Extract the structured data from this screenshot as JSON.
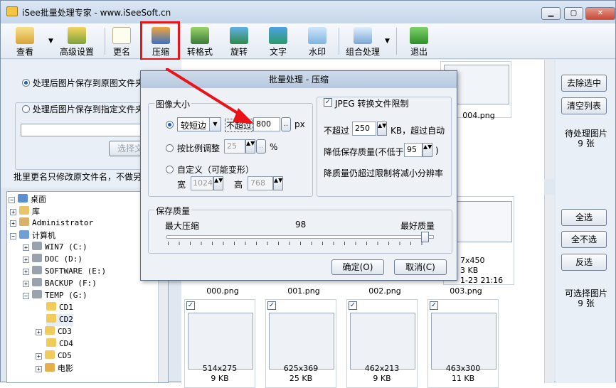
{
  "window": {
    "title": "iSee批量处理专家 - www.iSeeSoft.cn"
  },
  "toolbar": {
    "items": [
      {
        "label": "查看",
        "icon": "view-icon"
      },
      {
        "label": "高级设置",
        "icon": "advanced-settings-icon"
      },
      {
        "label": "更名",
        "icon": "rename-icon"
      },
      {
        "label": "压缩",
        "icon": "compress-icon"
      },
      {
        "label": "转格式",
        "icon": "convert-format-icon"
      },
      {
        "label": "旋转",
        "icon": "rotate-icon"
      },
      {
        "label": "文字",
        "icon": "text-icon"
      },
      {
        "label": "水印",
        "icon": "watermark-icon"
      },
      {
        "label": "组合处理",
        "icon": "combine-icon"
      },
      {
        "label": "退出",
        "icon": "exit-icon"
      }
    ]
  },
  "output": {
    "option_original": "处理后图片保存到原图文件夹",
    "option_specified": "处理后图片保存到指定文件夹",
    "choose_button": "选择文",
    "rename_note": "批里更名只修改原文件名，不做另"
  },
  "tree": {
    "rows": [
      {
        "label": "桌面",
        "icon": "desktop-icon"
      },
      {
        "label": "库",
        "icon": "library-icon"
      },
      {
        "label": "Administrator",
        "icon": "user-folder-icon"
      },
      {
        "label": "计算机",
        "icon": "computer-icon"
      },
      {
        "label": "WIN7 (C:)",
        "icon": "drive-icon"
      },
      {
        "label": "DOC (D:)",
        "icon": "drive-icon"
      },
      {
        "label": "SOFTWARE (E:)",
        "icon": "drive-icon"
      },
      {
        "label": "BACKUP (F:)",
        "icon": "drive-icon"
      },
      {
        "label": "TEMP (G:)",
        "icon": "drive-icon"
      },
      {
        "label": "CD1",
        "icon": "folder-icon"
      },
      {
        "label": "CD2",
        "icon": "folder-icon"
      },
      {
        "label": "CD3",
        "icon": "folder-icon"
      },
      {
        "label": "CD4",
        "icon": "folder-icon"
      },
      {
        "label": "CD5",
        "icon": "folder-icon"
      },
      {
        "label": "电影",
        "icon": "movie-folder-icon"
      }
    ]
  },
  "thumbnails": {
    "top_row": [
      {
        "name": "004.png"
      }
    ],
    "partial_info": {
      "size": "7x450",
      "kb": "3 KB",
      "date": "1-23 21:16"
    },
    "row1_names": [
      "000.png",
      "001.png",
      "002.png",
      "003.png"
    ],
    "row2": [
      {
        "dims": "514x275",
        "kb": "9 KB"
      },
      {
        "dims": "625x369",
        "kb": "25 KB"
      },
      {
        "dims": "462x213",
        "kb": "9 KB"
      },
      {
        "dims": "463x300",
        "kb": "11 KB"
      }
    ]
  },
  "right_panel": {
    "remove_selected": "去除选中",
    "clear_list": "清空列表",
    "pending_label": "待处理图片",
    "pending_count": "9 张",
    "select_all": "全选",
    "select_none": "全不选",
    "invert": "反选",
    "selectable_label": "可选择图片",
    "selectable_count": "9 张"
  },
  "dialog": {
    "title": "批量处理 - 压缩",
    "image_size_group": "图像大小",
    "short_edge_select": "较短边",
    "not_exceed_label": "不超过",
    "px_value": "800",
    "px_unit": "px",
    "scale_label": "按比例调整",
    "scale_value": "25",
    "percent": "%",
    "custom_label": "自定义（可能变形）",
    "width_label": "宽",
    "width_value": "1024",
    "height_label": "高",
    "height_value": "768",
    "jpeg_limit_label": "JPEG 转换文件限制",
    "kb_not_exceed": "不超过",
    "kb_value": "250",
    "kb_suffix": "KB，超过自动",
    "reduce_quality": "降低保存质量(不低于",
    "min_quality": "95",
    "close_paren": ")",
    "reduce_note": "降质量仍超过限制将减小分辨率",
    "quality_group": "保存质量",
    "max_compress": "最大压缩",
    "quality_value": "98",
    "best_quality": "最好质量",
    "ok": "确定(O)",
    "cancel": "取消(C)"
  },
  "quality_level": 0.98
}
